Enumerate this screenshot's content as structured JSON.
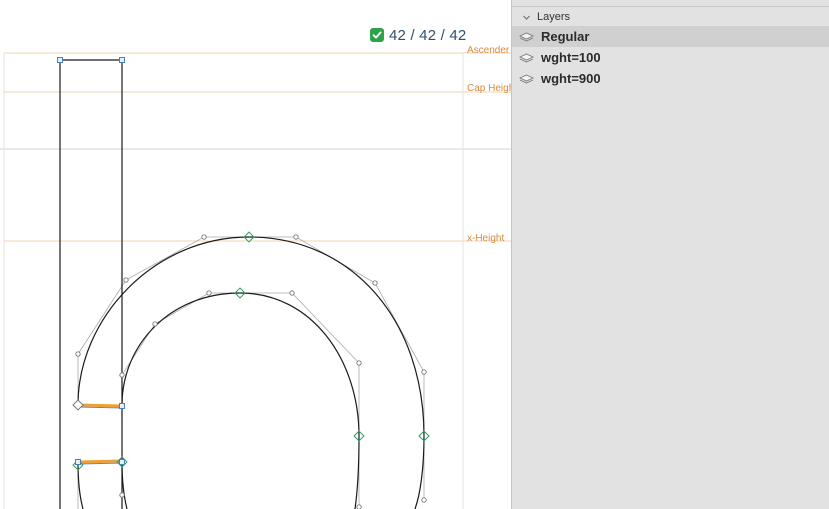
{
  "canvas": {
    "compatibility": {
      "icon": "check-icon",
      "text": "42 / 42 / 42",
      "color": "#2fa34c"
    },
    "metrics": [
      {
        "name": "ascender",
        "label": "Ascender"
      },
      {
        "name": "cap-height",
        "label": "Cap Height"
      },
      {
        "name": "x-height",
        "label": "x-Height"
      }
    ],
    "colors": {
      "metric_line": "#f2d4b3",
      "outline": "#1a1a1a",
      "handle": "#9a9a9a",
      "on_curve_smooth": "#2e9e62",
      "corner": "#4a7fc1",
      "highlight": "#f0a030"
    }
  },
  "panel": {
    "title": "Layers",
    "layers": [
      {
        "label": "Regular",
        "selected": true,
        "icon": "layers-icon"
      },
      {
        "label": "wght=100",
        "selected": false,
        "icon": "layers-icon"
      },
      {
        "label": "wght=900",
        "selected": false,
        "icon": "layers-icon"
      }
    ]
  }
}
